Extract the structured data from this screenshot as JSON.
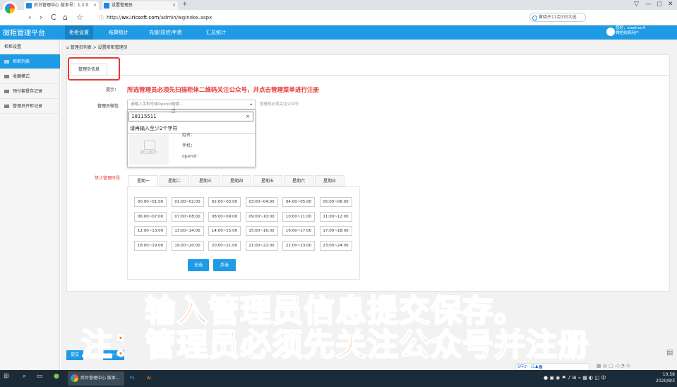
{
  "browser": {
    "tabs": [
      {
        "label": "后台管理中心 版本号：1.2.0"
      },
      {
        "label": "设置管理员"
      }
    ],
    "new_tab": "+",
    "url_prefix": "http://",
    "url_domain": "wx.iricsoft.com",
    "url_path": "/admin/wgIndex.aspx",
    "search_text": "黄晓于11月3日大选",
    "window_controls": [
      "▽",
      "—",
      "◻",
      "✕"
    ],
    "nav": [
      "‹",
      "›",
      "C",
      "⌂",
      "☆"
    ]
  },
  "app": {
    "brand": "微柜管理平台",
    "topnav": [
      "柜柜设置",
      "结算统计",
      "充值\\短信\\年费",
      "汇总统计"
    ],
    "user_greeting": "您好，xiaohou4",
    "user_role": "微柜结算用户"
  },
  "sidebar": {
    "title": "柜柜设置",
    "items": [
      "柜柜列表",
      "收藏模式",
      "预付套餐存记录",
      "管理员开柜记录"
    ]
  },
  "breadcrumb": {
    "home": "管理员列表",
    "sep": ">",
    "current": "设置柜柜管理员"
  },
  "form": {
    "tab_label": "管理员信息",
    "hint_label": "提示：",
    "hint_text": "所选管理员必须先扫描柜体二维码关注公众号，并点击管理菜单进行注册",
    "wechat_label": "管理员微信",
    "select_placeholder": "请输入手机号或OpenId搜索...",
    "select_note": "管理员必须关注公众号",
    "dropdown_input": "18115511",
    "dropdown_msg": "请再输入至少2个字符",
    "photo_text": "默认图片",
    "field_name": "姓名：",
    "field_phone": "手机：",
    "field_openid": "openId："
  },
  "schedule": {
    "label": "禁止管理时段",
    "days": [
      "星期一",
      "星期二",
      "星期三",
      "星期四",
      "星期五",
      "星期六",
      "星期日"
    ],
    "slots": [
      [
        "00:00~01:00",
        "01:00~02:00",
        "02:00~03:00",
        "03:00~04:00",
        "04:00~05:00",
        "05:00~06:00"
      ],
      [
        "06:00~07:00",
        "07:00~08:00",
        "08:00~09:00",
        "09:00~10:00",
        "10:00~11:00",
        "11:00~12:00"
      ],
      [
        "12:00~13:00",
        "13:00~14:00",
        "14:00~15:00",
        "15:00~16:00",
        "16:00~17:00",
        "17:00~18:00"
      ],
      [
        "18:00~19:00",
        "19:00~20:00",
        "20:00~21:00",
        "21:00~22:00",
        "22:00~23:00",
        "23:00~24:00"
      ]
    ],
    "select_all": "全选",
    "invert": "反选"
  },
  "bottom_buttons": [
    "提交",
    "上一页"
  ],
  "captions": {
    "line1": "输入管理员信息提交保存。",
    "line2": "注：管理员必须先关注公众号并注册"
  },
  "ime_bar": "5中♪·◦☷♟▦",
  "taskbar": {
    "apps": [
      "后台管理中心 版本...",
      "Ps",
      "Ai"
    ],
    "time": "10:58",
    "date": "2020/8/3",
    "tray_ime": "中"
  },
  "colors": {
    "accent": "#1f9be6",
    "warning": "#e53935",
    "caption": "#ff7a1a",
    "taskbar": "#1c2b38"
  }
}
